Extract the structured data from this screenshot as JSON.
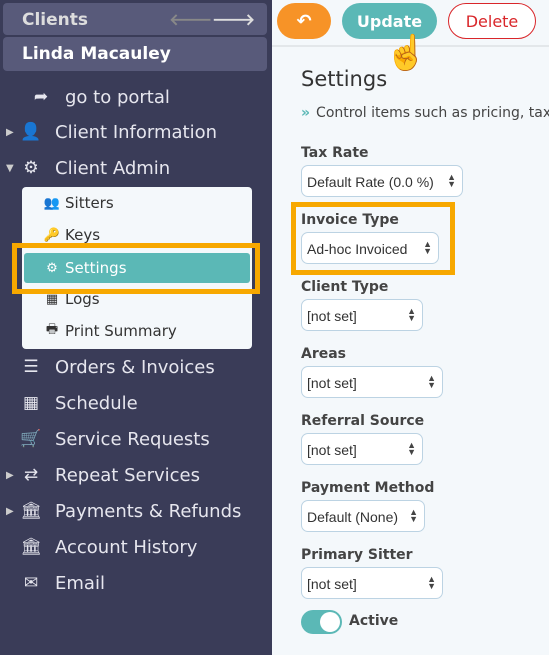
{
  "sidebar": {
    "header": "Clients",
    "client_name": "Linda Macauley",
    "items": [
      {
        "label": "go to portal",
        "icon": "share-arrow-icon"
      },
      {
        "label": "Client Information",
        "icon": "user-icon"
      },
      {
        "label": "Client Admin",
        "icon": "gear-icon"
      },
      {
        "label": "Orders & Invoices",
        "icon": "list-icon"
      },
      {
        "label": "Schedule",
        "icon": "calendar-icon"
      },
      {
        "label": "Service Requests",
        "icon": "cart-icon"
      },
      {
        "label": "Repeat Services",
        "icon": "repeat-icon"
      },
      {
        "label": "Payments & Refunds",
        "icon": "bank-icon"
      },
      {
        "label": "Account History",
        "icon": "bank-icon"
      },
      {
        "label": "Email",
        "icon": "envelope-icon"
      }
    ],
    "submenu": [
      {
        "label": "Sitters",
        "icon": "users-icon"
      },
      {
        "label": "Keys",
        "icon": "key-icon"
      },
      {
        "label": "Settings",
        "icon": "gear-icon"
      },
      {
        "label": "Logs",
        "icon": "table-icon"
      },
      {
        "label": "Print Summary",
        "icon": "print-icon"
      }
    ]
  },
  "toolbar": {
    "update": "Update",
    "delete": "Delete"
  },
  "main": {
    "title": "Settings",
    "description": "Control items such as pricing, tax",
    "fields": [
      {
        "label": "Tax Rate",
        "value": "Default Rate (0.0 %)"
      },
      {
        "label": "Invoice Type",
        "value": "Ad-hoc Invoiced"
      },
      {
        "label": "Client Type",
        "value": "[not set]"
      },
      {
        "label": "Areas",
        "value": "[not set]"
      },
      {
        "label": "Referral Source",
        "value": "[not set]"
      },
      {
        "label": "Payment Method",
        "value": "Default (None)"
      },
      {
        "label": "Primary Sitter",
        "value": "[not set]"
      }
    ],
    "active_label": "Active",
    "active": true
  },
  "colors": {
    "accent": "#5bb8b6",
    "highlight": "#f7a800",
    "back": "#f79327",
    "danger": "#d9262a",
    "sidebar": "#3a3c58"
  }
}
